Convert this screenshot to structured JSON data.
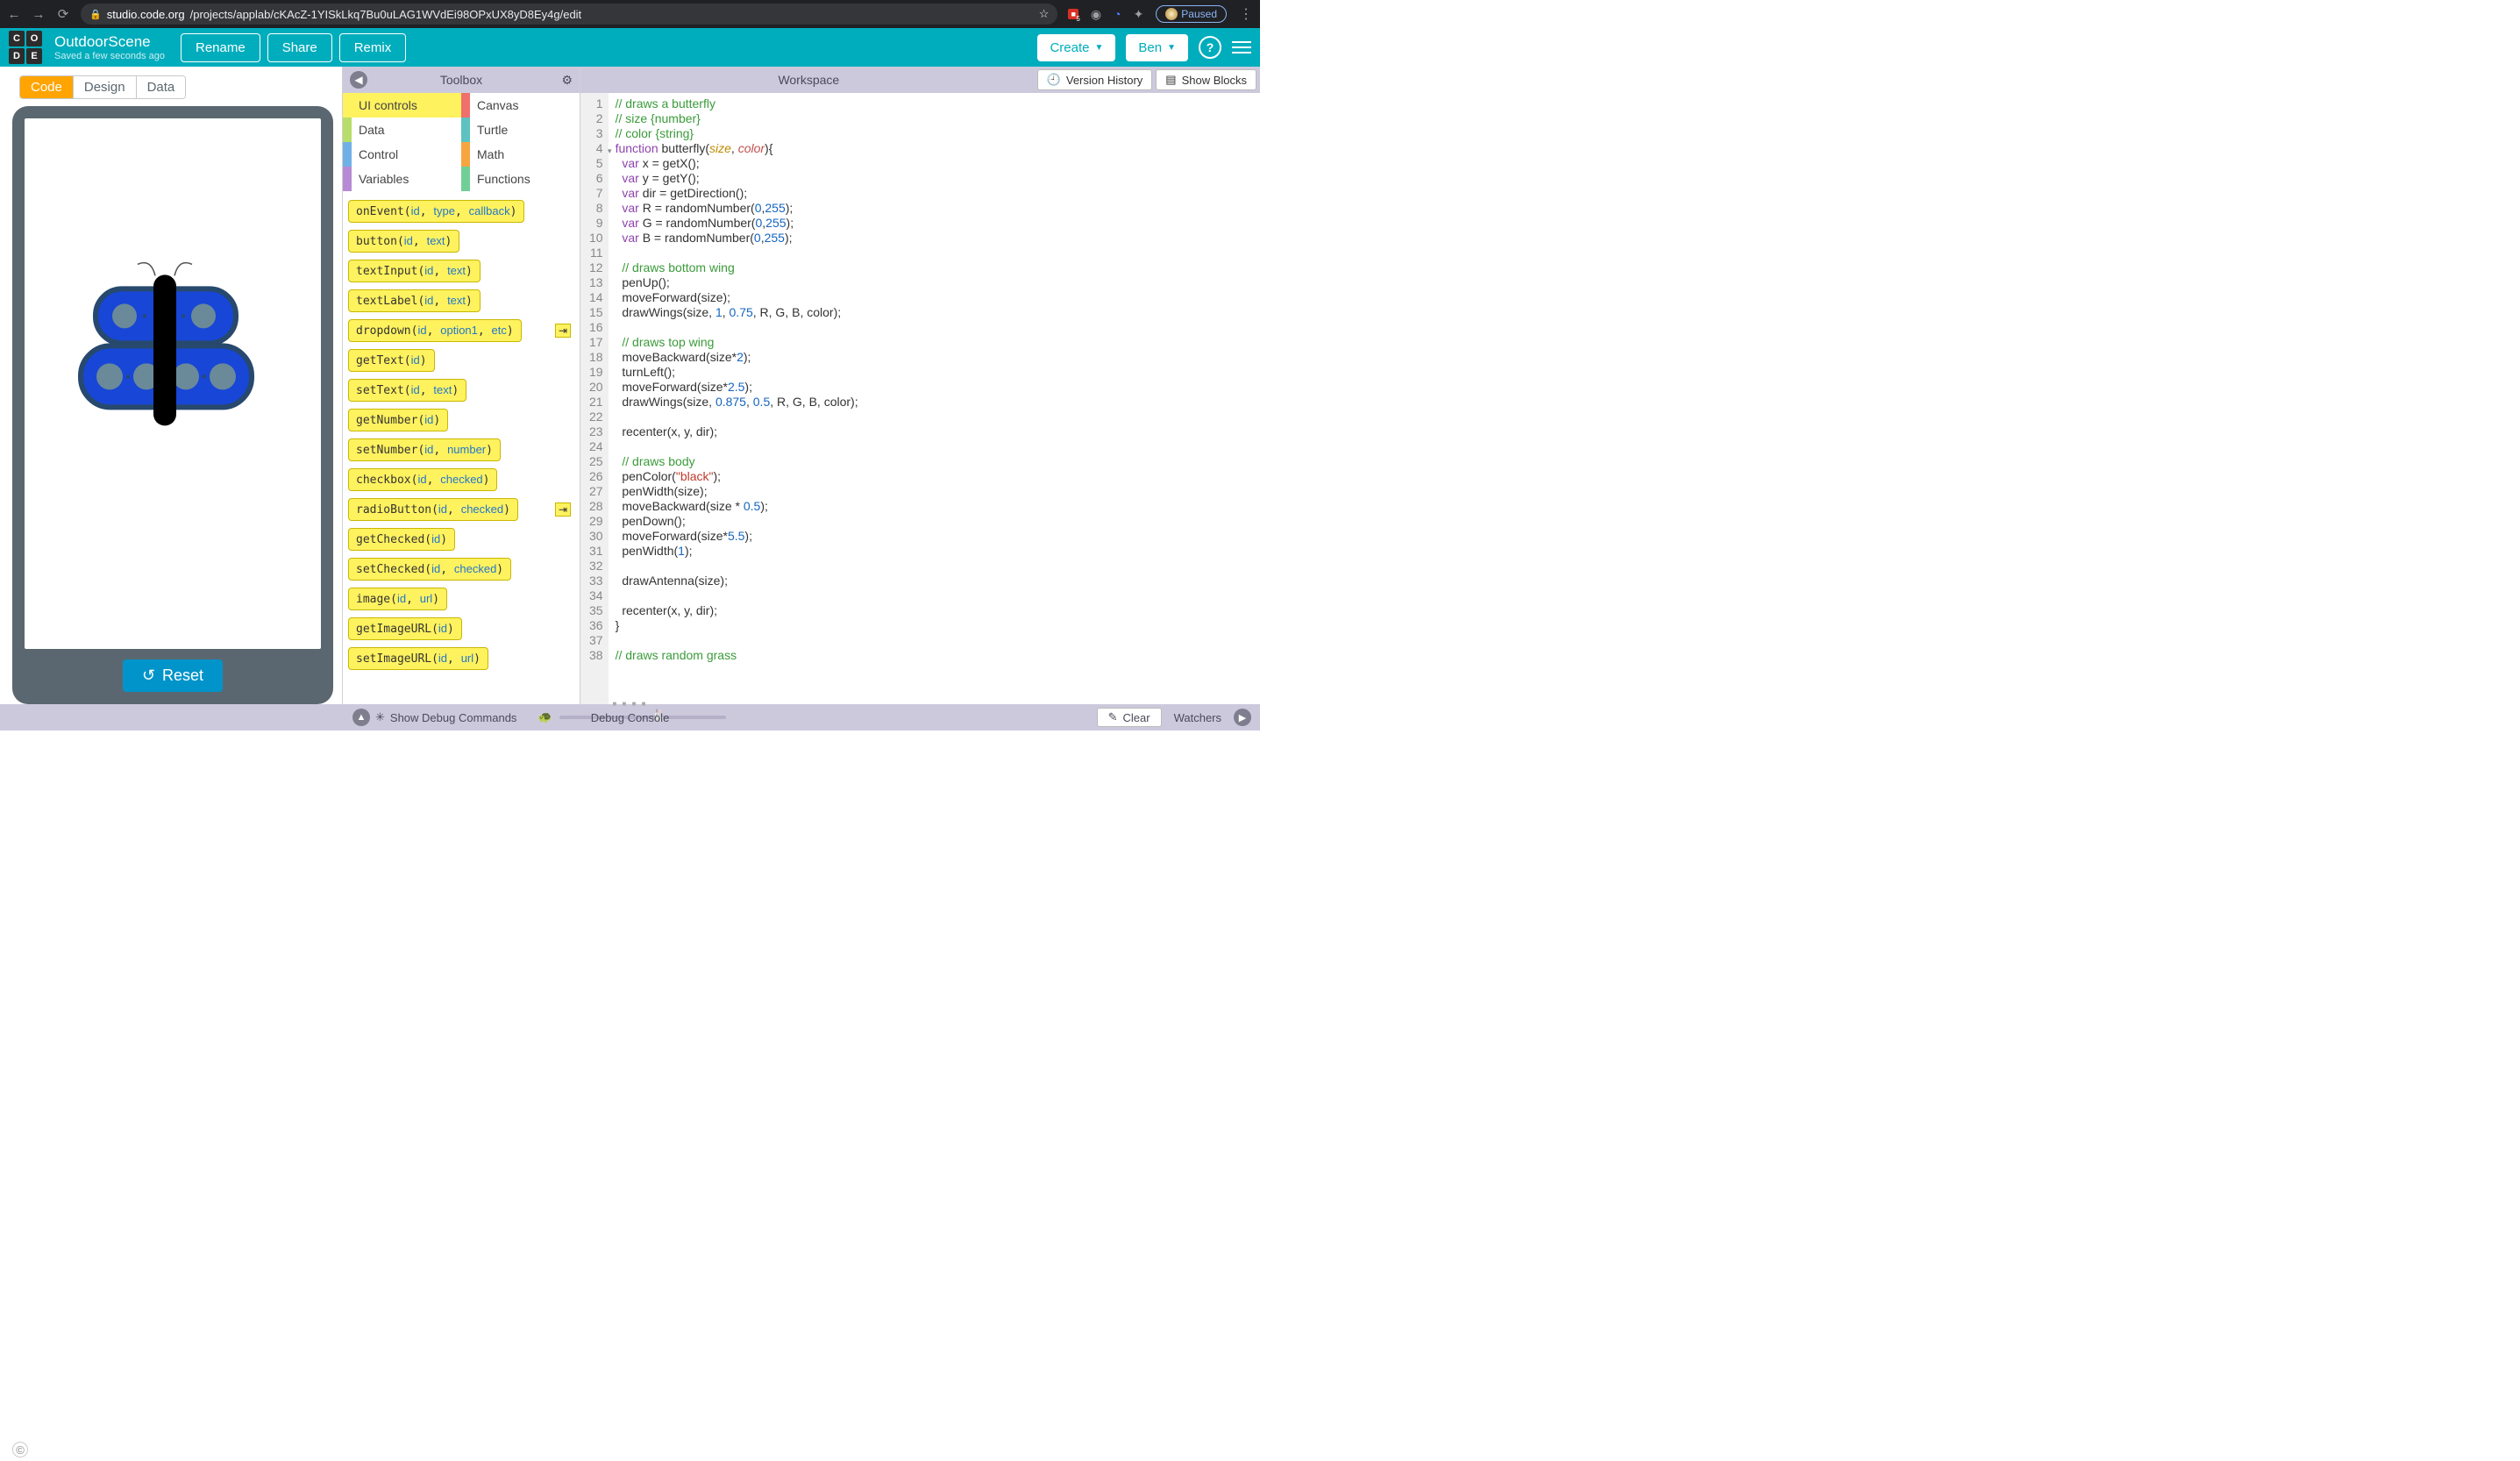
{
  "browser": {
    "url_host": "studio.code.org",
    "url_path": "/projects/applab/cKAcZ-1YISkLkq7Bu0uLAG1WVdEi98OPxUX8yD8Ey4g/edit",
    "ext_badge": "5",
    "paused": "Paused"
  },
  "header": {
    "title": "OutdoorScene",
    "subtitle": "Saved a few seconds ago",
    "rename": "Rename",
    "share": "Share",
    "remix": "Remix",
    "create": "Create",
    "user": "Ben"
  },
  "modeTabs": {
    "code": "Code",
    "design": "Design",
    "data": "Data"
  },
  "reset": "Reset",
  "toolbox": {
    "title": "Toolbox",
    "categories": [
      {
        "label": "UI controls",
        "color": "#fff25f",
        "active": true
      },
      {
        "label": "Canvas",
        "color": "#ef6f6c"
      },
      {
        "label": "Data",
        "color": "#b7dd6a"
      },
      {
        "label": "Turtle",
        "color": "#5ec2c2"
      },
      {
        "label": "Control",
        "color": "#6fb1e7"
      },
      {
        "label": "Math",
        "color": "#f7a541"
      },
      {
        "label": "Variables",
        "color": "#b78ad6"
      },
      {
        "label": "Functions",
        "color": "#6fcf97"
      }
    ],
    "blocks": [
      {
        "name": "onEvent",
        "params": "(id, type, callback)"
      },
      {
        "name": "button",
        "params": "(id, text)"
      },
      {
        "name": "textInput",
        "params": "(id, text)"
      },
      {
        "name": "textLabel",
        "params": "(id, text)"
      },
      {
        "name": "dropdown",
        "params": "(id, option1, etc)",
        "arrow": true
      },
      {
        "name": "getText",
        "params": "(id)"
      },
      {
        "name": "setText",
        "params": "(id, text)"
      },
      {
        "name": "getNumber",
        "params": "(id)"
      },
      {
        "name": "setNumber",
        "params": "(id, number)"
      },
      {
        "name": "checkbox",
        "params": "(id, checked)"
      },
      {
        "name": "radioButton",
        "params": "(id, checked)",
        "arrow": true
      },
      {
        "name": "getChecked",
        "params": "(id)"
      },
      {
        "name": "setChecked",
        "params": "(id, checked)"
      },
      {
        "name": "image",
        "params": "(id, url)"
      },
      {
        "name": "getImageURL",
        "params": "(id)"
      },
      {
        "name": "setImageURL",
        "params": "(id, url)"
      }
    ]
  },
  "workspace": {
    "title": "Workspace",
    "version_history": "Version History",
    "show_blocks": "Show Blocks"
  },
  "code_lines": [
    {
      "n": 1,
      "html": "<span class=c-com>// draws a butterfly</span>"
    },
    {
      "n": 2,
      "html": "<span class=c-com>// size {number}</span>"
    },
    {
      "n": 3,
      "html": "<span class=c-com>// color {string}</span>"
    },
    {
      "n": 4,
      "html": "<span class=c-kw>function</span> <span class=c-fn>butterfly</span>(<span class=c-par1>size</span>, <span class=c-par2>color</span>){",
      "fold": true
    },
    {
      "n": 5,
      "html": "  <span class=c-kw>var</span> x = getX();"
    },
    {
      "n": 6,
      "html": "  <span class=c-kw>var</span> y = getY();"
    },
    {
      "n": 7,
      "html": "  <span class=c-kw>var</span> dir = getDirection();"
    },
    {
      "n": 8,
      "html": "  <span class=c-kw>var</span> R = randomNumber(<span class=c-num>0</span>,<span class=c-num>255</span>);"
    },
    {
      "n": 9,
      "html": "  <span class=c-kw>var</span> G = randomNumber(<span class=c-num>0</span>,<span class=c-num>255</span>);"
    },
    {
      "n": 10,
      "html": "  <span class=c-kw>var</span> B = randomNumber(<span class=c-num>0</span>,<span class=c-num>255</span>);"
    },
    {
      "n": 11,
      "html": "  "
    },
    {
      "n": 12,
      "html": "  <span class=c-com>// draws bottom wing</span>"
    },
    {
      "n": 13,
      "html": "  penUp();"
    },
    {
      "n": 14,
      "html": "  moveForward(size);"
    },
    {
      "n": 15,
      "html": "  drawWings(size, <span class=c-num>1</span>, <span class=c-num>0.75</span>, R, G, B, color);"
    },
    {
      "n": 16,
      "html": "  "
    },
    {
      "n": 17,
      "html": "  <span class=c-com>// draws top wing</span>"
    },
    {
      "n": 18,
      "html": "  moveBackward(size*<span class=c-num>2</span>);"
    },
    {
      "n": 19,
      "html": "  turnLeft();"
    },
    {
      "n": 20,
      "html": "  moveForward(size*<span class=c-num>2.5</span>);"
    },
    {
      "n": 21,
      "html": "  drawWings(size, <span class=c-num>0.875</span>, <span class=c-num>0.5</span>, R, G, B, color);"
    },
    {
      "n": 22,
      "html": "  "
    },
    {
      "n": 23,
      "html": "  recenter(x, y, dir);"
    },
    {
      "n": 24,
      "html": "  "
    },
    {
      "n": 25,
      "html": "  <span class=c-com>// draws body</span>"
    },
    {
      "n": 26,
      "html": "  penColor(<span class=c-str>\"black\"</span>);"
    },
    {
      "n": 27,
      "html": "  penWidth(size);"
    },
    {
      "n": 28,
      "html": "  moveBackward(size * <span class=c-num>0.5</span>);"
    },
    {
      "n": 29,
      "html": "  penDown();"
    },
    {
      "n": 30,
      "html": "  moveForward(size*<span class=c-num>5.5</span>);"
    },
    {
      "n": 31,
      "html": "  penWidth(<span class=c-num>1</span>);"
    },
    {
      "n": 32,
      "html": "  "
    },
    {
      "n": 33,
      "html": "  drawAntenna(size);"
    },
    {
      "n": 34,
      "html": "  "
    },
    {
      "n": 35,
      "html": "  recenter(x, y, dir);"
    },
    {
      "n": 36,
      "html": "}"
    },
    {
      "n": 37,
      "html": ""
    },
    {
      "n": 38,
      "html": "<span class=c-com>// draws random grass</span>"
    }
  ],
  "debug": {
    "show_cmds": "Show Debug Commands",
    "console": "Debug Console",
    "clear": "Clear",
    "watchers": "Watchers"
  }
}
